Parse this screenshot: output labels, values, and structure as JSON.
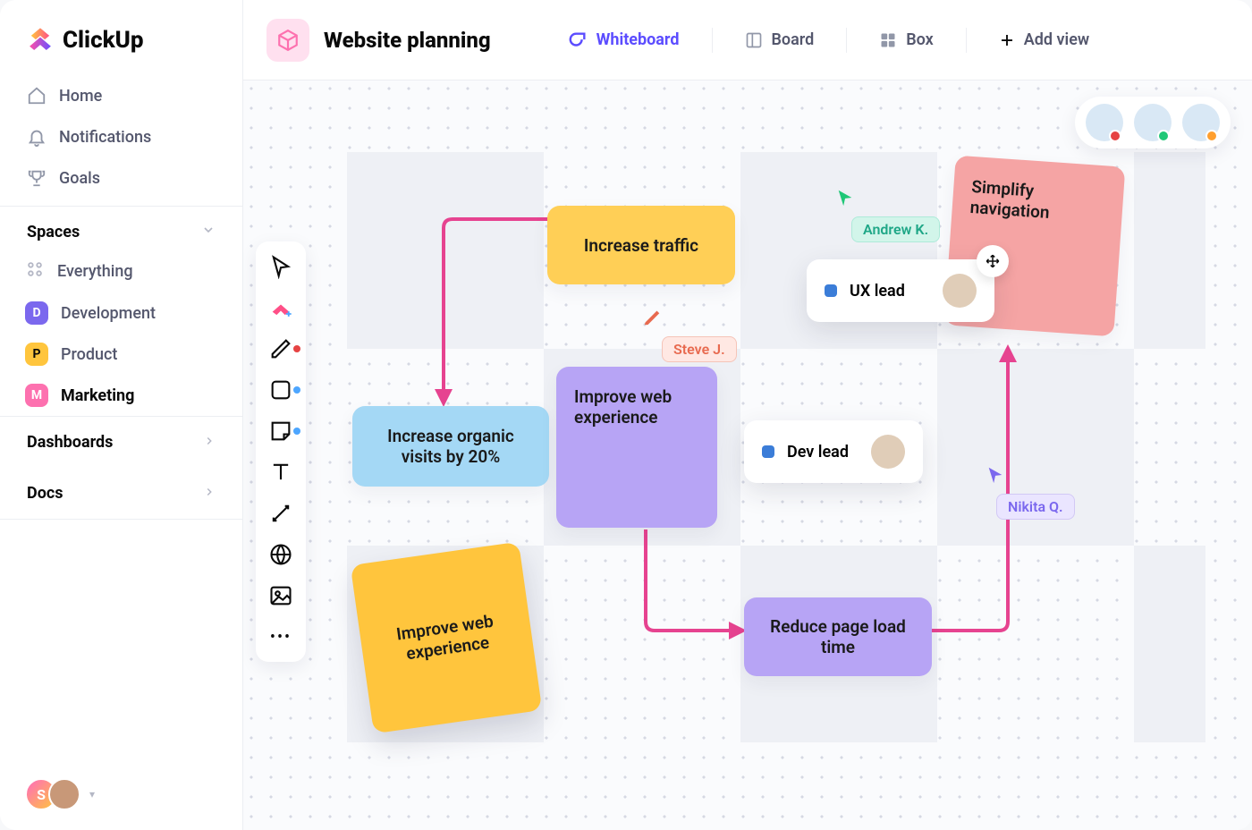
{
  "brand": "ClickUp",
  "nav": {
    "home": "Home",
    "notifications": "Notifications",
    "goals": "Goals"
  },
  "sections": {
    "spaces": "Spaces",
    "everything": "Everything",
    "dashboards": "Dashboards",
    "docs": "Docs"
  },
  "spaces": {
    "dev": {
      "badge": "D",
      "label": "Development"
    },
    "prod": {
      "badge": "P",
      "label": "Product"
    },
    "mkt": {
      "badge": "M",
      "label": "Marketing"
    }
  },
  "header": {
    "title": "Website planning",
    "views": {
      "whiteboard": "Whiteboard",
      "board": "Board",
      "box": "Box",
      "add": "Add view"
    }
  },
  "nodes": {
    "traffic": "Increase traffic",
    "organic": "Increase organic visits by 20%",
    "improve1": "Improve web experience",
    "improve2": "Improve web experience",
    "simplify": "Simplify navigation",
    "reduce": "Reduce page load time"
  },
  "cards": {
    "ux": "UX lead",
    "dev": "Dev lead"
  },
  "cursors": {
    "andrew": "Andrew K.",
    "steve": "Steve J.",
    "nikita": "Nikita Q."
  },
  "footer_avatar": "S"
}
